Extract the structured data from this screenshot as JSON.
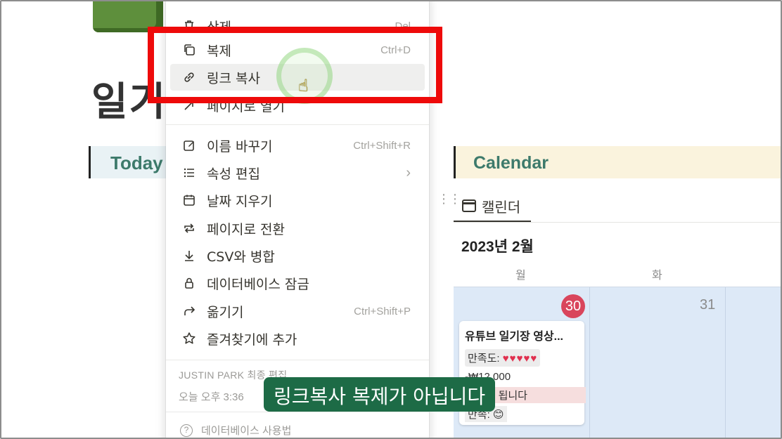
{
  "page": {
    "title": "일기",
    "today_label": "Today"
  },
  "calendar": {
    "heading": "Calendar",
    "view_tab_label": "캘린더",
    "month_label": "2023년 2월",
    "weekdays": [
      "월",
      "화"
    ],
    "days": [
      "30",
      "31"
    ],
    "event": {
      "title": "유튜브 일기장 영상...",
      "rating_label": "만족도:",
      "rating_hearts": "♥♥♥♥♥",
      "amount": "-₩12,000",
      "tag": "복리가 됩니다",
      "satisfaction": "만족: 😊"
    }
  },
  "context_menu": {
    "items": [
      {
        "label": "삭제",
        "shortcut": "Del",
        "icon": "trash-icon"
      },
      {
        "label": "복제",
        "shortcut": "Ctrl+D",
        "icon": "duplicate-icon"
      },
      {
        "label": "링크 복사",
        "shortcut": "",
        "icon": "link-icon"
      },
      {
        "label": "페이지로 열기",
        "shortcut": "",
        "icon": "open-page-icon"
      },
      {
        "label": "이름 바꾸기",
        "shortcut": "Ctrl+Shift+R",
        "icon": "rename-icon"
      },
      {
        "label": "속성 편집",
        "shortcut": "",
        "icon": "list-icon"
      },
      {
        "label": "날짜 지우기",
        "shortcut": "",
        "icon": "calendar-clear-icon"
      },
      {
        "label": "페이지로 전환",
        "shortcut": "",
        "icon": "convert-icon"
      },
      {
        "label": "CSV와 병합",
        "shortcut": "",
        "icon": "download-icon"
      },
      {
        "label": "데이터베이스 잠금",
        "shortcut": "",
        "icon": "lock-icon"
      },
      {
        "label": "옮기기",
        "shortcut": "Ctrl+Shift+P",
        "icon": "move-icon"
      },
      {
        "label": "즐겨찾기에 추가",
        "shortcut": "",
        "icon": "star-icon"
      }
    ],
    "editor": "JUSTIN PARK 최종 편집",
    "edited_time": "오늘 오후 3:36",
    "help_label": "데이터베이스 사용법"
  },
  "subtitle": "링크복사 복제가 아닙니다",
  "colors": {
    "highlight": "#ee0a0a",
    "subtitle_bg": "#1d6b46",
    "accent_heading": "#3d7a6b",
    "today_badge": "#d9455c"
  }
}
